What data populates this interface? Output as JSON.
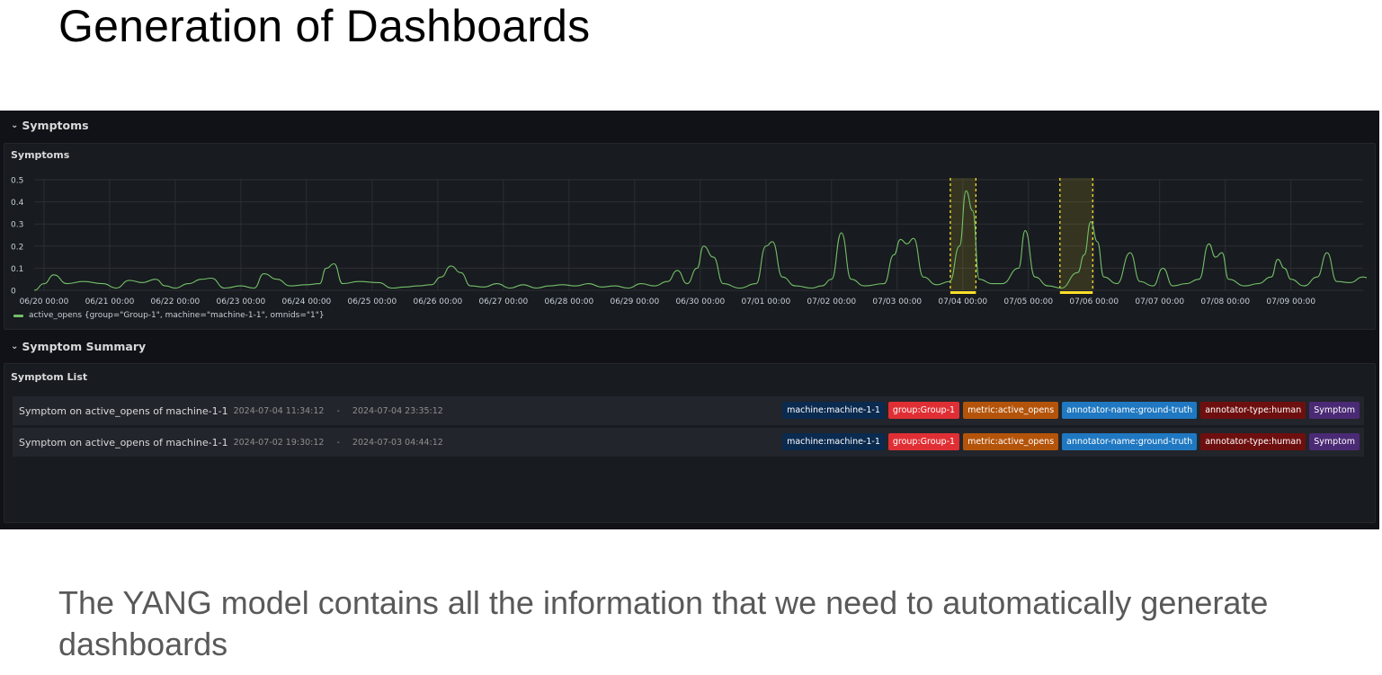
{
  "slide": {
    "title": "Generation of Dashboards",
    "caption": "The YANG model contains all the information that we need to automatically generate dashboards"
  },
  "dashboard": {
    "row1_title": "Symptoms",
    "panel1_title": "Symptoms",
    "legend": "active_opens {group=\"Group-1\", machine=\"machine-1-1\", omnids=\"1\"}",
    "row2_title": "Symptom Summary",
    "panel2_title": "Symptom List"
  },
  "chart_data": {
    "type": "line",
    "title": "Symptoms",
    "y_ticks": [
      "0",
      "0.1",
      "0.2",
      "0.3",
      "0.4",
      "0.5"
    ],
    "x_ticks": [
      "06/20 00:00",
      "06/21 00:00",
      "06/22 00:00",
      "06/23 00:00",
      "06/24 00:00",
      "06/25 00:00",
      "06/26 00:00",
      "06/27 00:00",
      "06/28 00:00",
      "06/29 00:00",
      "06/30 00:00",
      "07/01 00:00",
      "07/02 00:00",
      "07/03 00:00",
      "07/04 00:00",
      "07/05 00:00",
      "07/06 00:00",
      "07/07 00:00",
      "07/08 00:00",
      "07/09 00:00"
    ],
    "ylim": [
      0,
      0.5
    ],
    "xlim_days": [
      -0.15,
      20.1
    ],
    "grid": true,
    "legend_position": "bottom-left",
    "line_color": "#73bf69",
    "annotation_color": "#fade2a",
    "annotation_regions_days": [
      [
        13.81,
        14.2
      ],
      [
        15.48,
        15.98
      ]
    ],
    "series": [
      {
        "name": "active_opens {group=\"Group-1\", machine=\"machine-1-1\", omnids=\"1\"}",
        "points_days": [
          [
            -0.15,
            0.0
          ],
          [
            0.0,
            0.03
          ],
          [
            0.15,
            0.07
          ],
          [
            0.35,
            0.03
          ],
          [
            0.6,
            0.04
          ],
          [
            0.9,
            0.03
          ],
          [
            1.1,
            0.01
          ],
          [
            1.3,
            0.045
          ],
          [
            1.5,
            0.035
          ],
          [
            1.7,
            0.05
          ],
          [
            1.85,
            0.02
          ],
          [
            2.0,
            0.01
          ],
          [
            2.2,
            0.03
          ],
          [
            2.4,
            0.05
          ],
          [
            2.55,
            0.055
          ],
          [
            2.75,
            0.01
          ],
          [
            3.0,
            0.02
          ],
          [
            3.2,
            0.01
          ],
          [
            3.35,
            0.075
          ],
          [
            3.55,
            0.05
          ],
          [
            3.75,
            0.02
          ],
          [
            4.0,
            0.025
          ],
          [
            4.2,
            0.03
          ],
          [
            4.3,
            0.1
          ],
          [
            4.42,
            0.12
          ],
          [
            4.55,
            0.03
          ],
          [
            4.8,
            0.04
          ],
          [
            5.1,
            0.035
          ],
          [
            5.3,
            0.01
          ],
          [
            5.5,
            0.015
          ],
          [
            5.7,
            0.02
          ],
          [
            5.9,
            0.025
          ],
          [
            6.05,
            0.06
          ],
          [
            6.2,
            0.11
          ],
          [
            6.35,
            0.08
          ],
          [
            6.5,
            0.02
          ],
          [
            6.7,
            0.015
          ],
          [
            6.9,
            0.03
          ],
          [
            7.1,
            0.01
          ],
          [
            7.3,
            0.025
          ],
          [
            7.5,
            0.01
          ],
          [
            7.7,
            0.02
          ],
          [
            7.9,
            0.025
          ],
          [
            8.1,
            0.02
          ],
          [
            8.3,
            0.03
          ],
          [
            8.5,
            0.015
          ],
          [
            8.7,
            0.02
          ],
          [
            8.9,
            0.01
          ],
          [
            9.1,
            0.03
          ],
          [
            9.3,
            0.02
          ],
          [
            9.5,
            0.04
          ],
          [
            9.65,
            0.09
          ],
          [
            9.8,
            0.03
          ],
          [
            9.95,
            0.1
          ],
          [
            10.05,
            0.2
          ],
          [
            10.2,
            0.15
          ],
          [
            10.35,
            0.03
          ],
          [
            10.6,
            0.01
          ],
          [
            10.85,
            0.03
          ],
          [
            11.0,
            0.2
          ],
          [
            11.1,
            0.22
          ],
          [
            11.25,
            0.06
          ],
          [
            11.45,
            0.02
          ],
          [
            11.7,
            0.01
          ],
          [
            11.85,
            0.02
          ],
          [
            12.0,
            0.05
          ],
          [
            12.15,
            0.26
          ],
          [
            12.3,
            0.05
          ],
          [
            12.5,
            0.02
          ],
          [
            12.8,
            0.03
          ],
          [
            12.95,
            0.16
          ],
          [
            13.05,
            0.23
          ],
          [
            13.15,
            0.21
          ],
          [
            13.25,
            0.235
          ],
          [
            13.4,
            0.06
          ],
          [
            13.6,
            0.025
          ],
          [
            13.8,
            0.04
          ],
          [
            13.95,
            0.2
          ],
          [
            14.05,
            0.45
          ],
          [
            14.15,
            0.36
          ],
          [
            14.25,
            0.05
          ],
          [
            14.45,
            0.03
          ],
          [
            14.6,
            0.03
          ],
          [
            14.85,
            0.1
          ],
          [
            14.95,
            0.27
          ],
          [
            15.1,
            0.06
          ],
          [
            15.3,
            0.02
          ],
          [
            15.5,
            0.01
          ],
          [
            15.75,
            0.08
          ],
          [
            15.85,
            0.16
          ],
          [
            15.95,
            0.31
          ],
          [
            16.05,
            0.22
          ],
          [
            16.15,
            0.06
          ],
          [
            16.35,
            0.03
          ],
          [
            16.55,
            0.17
          ],
          [
            16.7,
            0.04
          ],
          [
            16.9,
            0.02
          ],
          [
            17.05,
            0.1
          ],
          [
            17.2,
            0.02
          ],
          [
            17.4,
            0.03
          ],
          [
            17.6,
            0.05
          ],
          [
            17.75,
            0.21
          ],
          [
            17.85,
            0.15
          ],
          [
            17.95,
            0.17
          ],
          [
            18.05,
            0.05
          ],
          [
            18.3,
            0.02
          ],
          [
            18.5,
            0.03
          ],
          [
            18.7,
            0.06
          ],
          [
            18.8,
            0.14
          ],
          [
            18.9,
            0.1
          ],
          [
            19.0,
            0.05
          ],
          [
            19.2,
            0.02
          ],
          [
            19.4,
            0.06
          ],
          [
            19.55,
            0.17
          ],
          [
            19.7,
            0.04
          ],
          [
            19.9,
            0.035
          ],
          [
            20.1,
            0.06
          ],
          [
            20.3,
            0.03
          ],
          [
            20.5,
            0.01
          ],
          [
            20.75,
            0.08
          ],
          [
            20.85,
            0.15
          ],
          [
            20.95,
            0.12
          ],
          [
            21.05,
            0.06
          ]
        ]
      }
    ]
  },
  "symptom_list": [
    {
      "name": "Symptom on active_opens of machine-1-1",
      "start": "2024-07-04 11:34:12",
      "sep": "-",
      "end": "2024-07-04 23:35:12",
      "tags": [
        {
          "label": "machine:machine-1-1",
          "color": "#0a2a4f"
        },
        {
          "label": "group:Group-1",
          "color": "#e02f34"
        },
        {
          "label": "metric:active_opens",
          "color": "#b4540a"
        },
        {
          "label": "annotator-name:ground-truth",
          "color": "#1f78c1"
        },
        {
          "label": "annotator-type:human",
          "color": "#6e0f0f"
        },
        {
          "label": "Symptom",
          "color": "#4b2a75"
        }
      ]
    },
    {
      "name": "Symptom on active_opens of machine-1-1",
      "start": "2024-07-02 19:30:12",
      "sep": "-",
      "end": "2024-07-03 04:44:12",
      "tags": [
        {
          "label": "machine:machine-1-1",
          "color": "#0a2a4f"
        },
        {
          "label": "group:Group-1",
          "color": "#e02f34"
        },
        {
          "label": "metric:active_opens",
          "color": "#b4540a"
        },
        {
          "label": "annotator-name:ground-truth",
          "color": "#1f78c1"
        },
        {
          "label": "annotator-type:human",
          "color": "#6e0f0f"
        },
        {
          "label": "Symptom",
          "color": "#4b2a75"
        }
      ]
    }
  ]
}
